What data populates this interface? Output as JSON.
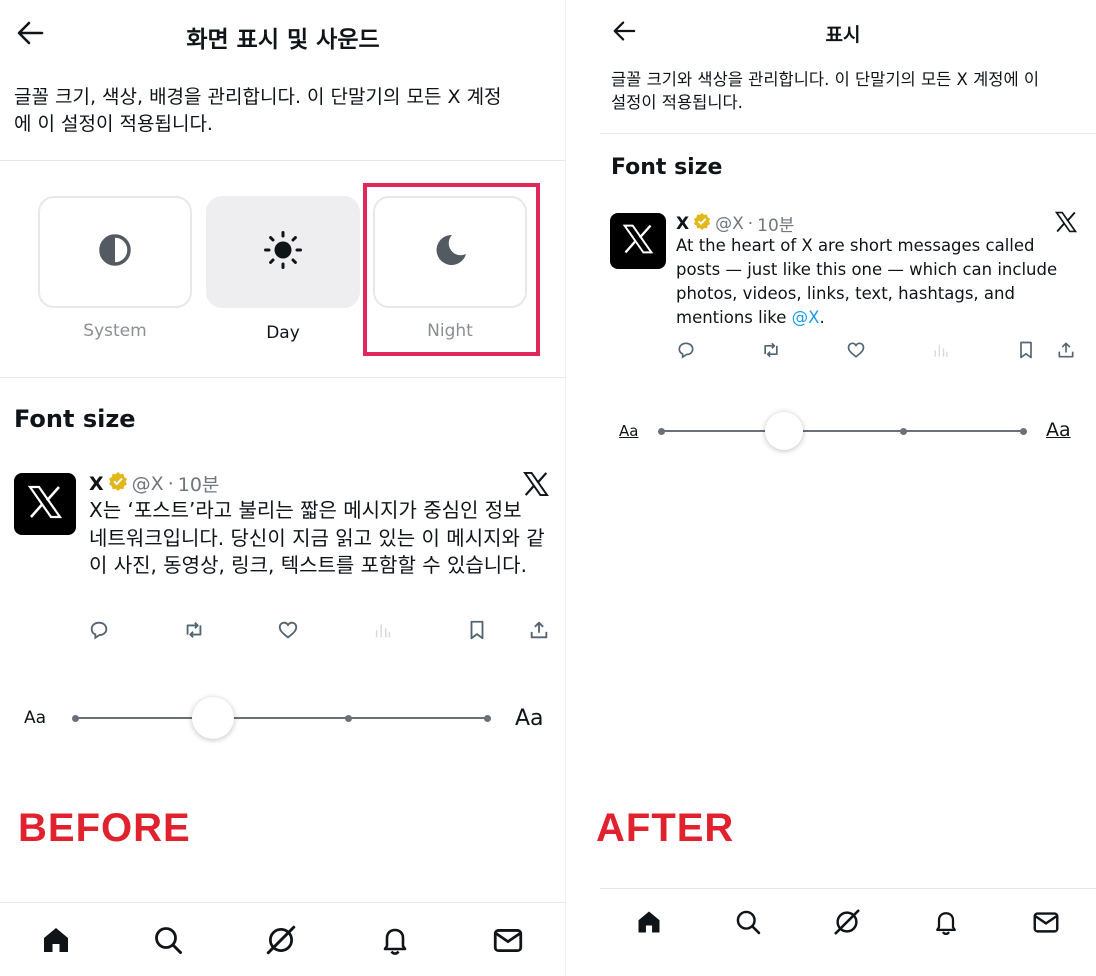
{
  "before": {
    "title": "화면 표시 및 사운드",
    "description": "글꼴 크기, 색상, 배경을 관리합니다. 이 단말기의 모든 X 계정\n에 이 설정이 적용됩니다.",
    "themes": [
      {
        "label": "System",
        "icon": "half-circle-icon"
      },
      {
        "label": "Day",
        "icon": "sun-icon"
      },
      {
        "label": "Night",
        "icon": "moon-icon"
      }
    ],
    "selected_theme": "Day",
    "highlighted_theme": "Night",
    "font_size_title": "Font size",
    "post": {
      "name": "X",
      "handle": "@X",
      "separator": "·",
      "time": "10분",
      "body": "X는 ‘포스트’라고 불리는 짧은 메시지가 중심인 정보 네트워크입니다. 당신이 지금 읽고 있는 이 메시지와 같이 사진, 동영상, 링크, 텍스트를 포함할 수 있습니다."
    },
    "slider": {
      "min_label": "Aa",
      "max_label": "Aa",
      "steps": 5,
      "value_step": 2
    },
    "caption": "BEFORE"
  },
  "after": {
    "title": "표시",
    "description": "글꼴 크기와 색상을 관리합니다. 이 단말기의 모든 X 계정에 이\n설정이 적용됩니다.",
    "font_size_title": "Font size",
    "post": {
      "name": "X",
      "handle": "@X",
      "separator": "·",
      "time": "10분",
      "body_prefix": "At the heart of X are short messages called posts — just like this one — which can include photos, videos, links, text, hashtags, and mentions like ",
      "body_mention": "@X",
      "body_suffix": "."
    },
    "slider": {
      "min_label": "Aa",
      "max_label": "Aa",
      "steps": 5,
      "value_step": 2
    },
    "caption": "AFTER"
  },
  "nav_icons": [
    "home-icon",
    "search-icon",
    "grok-icon",
    "notifications-icon",
    "messages-icon"
  ],
  "colors": {
    "caption_red": "#e0222e",
    "highlight_pink": "#e0285a",
    "mention_blue": "#1d9bf0",
    "verified_gold": "#e2b719",
    "meta_gray": "#6f767c"
  }
}
